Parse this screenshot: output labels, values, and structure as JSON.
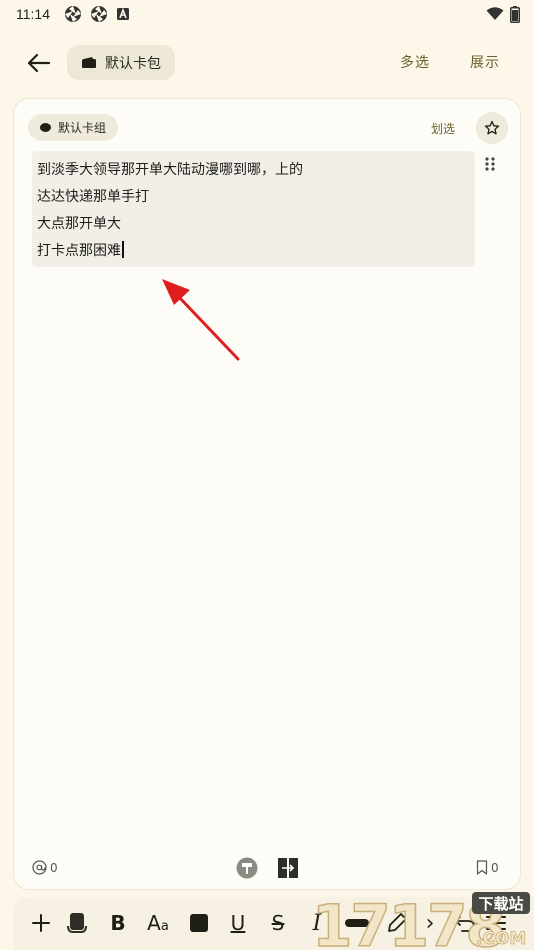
{
  "status_bar": {
    "time": "11:14"
  },
  "top_bar": {
    "wallet_label": "默认卡包",
    "multi_select_label": "多选",
    "display_label": "展示"
  },
  "card": {
    "group_label": "默认卡组",
    "select_label": "划选",
    "lines": [
      "到淡季大领导那开单大陆动漫哪到哪，上的",
      "达达快递那单手打",
      "大点那开单大",
      "打卡点那困难"
    ],
    "mention_count": "0",
    "bookmark_count": "0"
  },
  "watermark": {
    "number": "17178",
    "badge": "下载站",
    "suffix": ".COM"
  },
  "colors": {
    "background": "#fcf7e8",
    "accent_text": "#6b5f2a",
    "annotation_arrow": "#e01e1e"
  }
}
